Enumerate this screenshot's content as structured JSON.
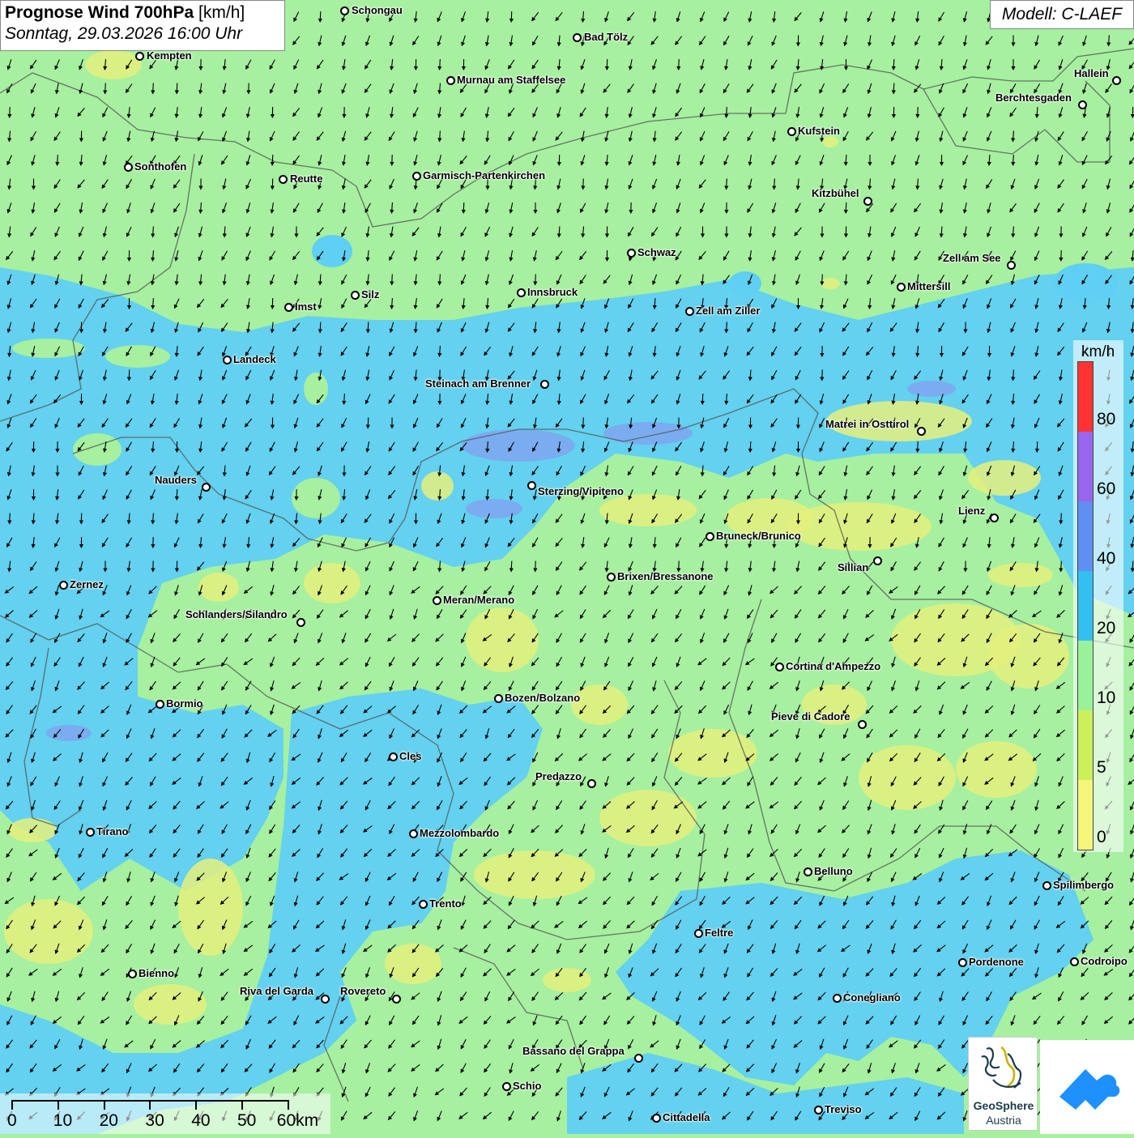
{
  "header": {
    "title": "Prognose Wind 700hPa",
    "unit": "[km/h]",
    "datetime": "Sonntag, 29.03.2026 16:00 Uhr",
    "model": "Modell: C-LAEF"
  },
  "legend": {
    "unit": "km/h",
    "labels": [
      "80",
      "60",
      "40",
      "20",
      "10",
      "5",
      "0"
    ],
    "colors": [
      "#ff3333",
      "#9966ee",
      "#5f8ff0",
      "#33bff0",
      "#99f199",
      "#ccf05a",
      "#f5f57a"
    ]
  },
  "scalebar": {
    "labels": [
      "0",
      "10",
      "20",
      "30",
      "40",
      "50",
      "60km"
    ]
  },
  "logo": {
    "line1": "GeoSphere",
    "line2": "Austria"
  },
  "cities": [
    {
      "name": "Schongau",
      "dot": [
        425,
        13
      ],
      "label": [
        434,
        13
      ]
    },
    {
      "name": "Bad Tölz",
      "dot": [
        712,
        46
      ],
      "label": [
        721,
        46
      ]
    },
    {
      "name": "Kempten",
      "dot": [
        172,
        69
      ],
      "label": [
        181,
        69
      ]
    },
    {
      "name": "Murnau am Staffelsee",
      "dot": [
        556,
        99
      ],
      "label": [
        564,
        99
      ]
    },
    {
      "name": "Hallein",
      "dot": [
        1378,
        99
      ],
      "label": [
        1326,
        91
      ]
    },
    {
      "name": "Berchtesgaden",
      "dot": [
        1336,
        129
      ],
      "label": [
        1229,
        121
      ]
    },
    {
      "name": "Kufstein",
      "dot": [
        977,
        162
      ],
      "label": [
        985,
        162
      ]
    },
    {
      "name": "Sonthofen",
      "dot": [
        158,
        206
      ],
      "label": [
        166,
        206
      ]
    },
    {
      "name": "Reutte",
      "dot": [
        349,
        221
      ],
      "label": [
        358,
        221
      ]
    },
    {
      "name": "Garmisch-Partenkirchen",
      "dot": [
        514,
        217
      ],
      "label": [
        522,
        217
      ]
    },
    {
      "name": "Kitzbühel",
      "dot": [
        1071,
        248
      ],
      "label": [
        1002,
        239
      ]
    },
    {
      "name": "Schwaz",
      "dot": [
        779,
        312
      ],
      "label": [
        787,
        312
      ]
    },
    {
      "name": "Zell am See",
      "dot": [
        1248,
        327
      ],
      "label": [
        1164,
        319
      ]
    },
    {
      "name": "Mittersill",
      "dot": [
        1112,
        354
      ],
      "label": [
        1120,
        354
      ]
    },
    {
      "name": "Innsbruck",
      "dot": [
        643,
        361
      ],
      "label": [
        651,
        361
      ]
    },
    {
      "name": "Silz",
      "dot": [
        438,
        364
      ],
      "label": [
        446,
        364
      ]
    },
    {
      "name": "Imst",
      "dot": [
        356,
        379
      ],
      "label": [
        364,
        379
      ]
    },
    {
      "name": "Zell am Ziller",
      "dot": [
        851,
        384
      ],
      "label": [
        859,
        384
      ]
    },
    {
      "name": "Landeck",
      "dot": [
        280,
        444
      ],
      "label": [
        288,
        444
      ]
    },
    {
      "name": "Steinach am Brenner",
      "dot": [
        672,
        474
      ],
      "label": [
        525,
        474
      ]
    },
    {
      "name": "Matrei in Osttirol",
      "dot": [
        1137,
        532
      ],
      "label": [
        1019,
        524
      ]
    },
    {
      "name": "Nauders",
      "dot": [
        254,
        601
      ],
      "label": [
        191,
        593
      ]
    },
    {
      "name": "Sterzing/Vipiteno",
      "dot": [
        656,
        599
      ],
      "label": [
        664,
        607
      ]
    },
    {
      "name": "Lienz",
      "dot": [
        1227,
        639
      ],
      "label": [
        1183,
        631
      ]
    },
    {
      "name": "Bruneck/Brunico",
      "dot": [
        876,
        662
      ],
      "label": [
        884,
        662
      ]
    },
    {
      "name": "Sillian",
      "dot": [
        1083,
        692
      ],
      "label": [
        1034,
        701
      ]
    },
    {
      "name": "Brixen/Bressanone",
      "dot": [
        754,
        712
      ],
      "label": [
        762,
        712
      ]
    },
    {
      "name": "Zernez",
      "dot": [
        78,
        722
      ],
      "label": [
        86,
        722
      ]
    },
    {
      "name": "Meran/Merano",
      "dot": [
        539,
        741
      ],
      "label": [
        547,
        741
      ]
    },
    {
      "name": "Schlanders/Silandro",
      "dot": [
        371,
        768
      ],
      "label": [
        229,
        759
      ]
    },
    {
      "name": "Cortina d'Ampezzo",
      "dot": [
        962,
        823
      ],
      "label": [
        970,
        823
      ]
    },
    {
      "name": "Bozen/Bolzano",
      "dot": [
        615,
        862
      ],
      "label": [
        623,
        862
      ]
    },
    {
      "name": "Bormio",
      "dot": [
        197,
        869
      ],
      "label": [
        205,
        869
      ]
    },
    {
      "name": "Pieve di Cadore",
      "dot": [
        1064,
        894
      ],
      "label": [
        952,
        885
      ]
    },
    {
      "name": "Cles",
      "dot": [
        485,
        934
      ],
      "label": [
        493,
        934
      ]
    },
    {
      "name": "Predazzo",
      "dot": [
        730,
        967
      ],
      "label": [
        661,
        959
      ]
    },
    {
      "name": "Tirano",
      "dot": [
        111,
        1027
      ],
      "label": [
        119,
        1027
      ]
    },
    {
      "name": "Mezzolombardo",
      "dot": [
        510,
        1029
      ],
      "label": [
        518,
        1029
      ]
    },
    {
      "name": "Belluno",
      "dot": [
        997,
        1076
      ],
      "label": [
        1005,
        1076
      ]
    },
    {
      "name": "Spilimbergo",
      "dot": [
        1292,
        1093
      ],
      "label": [
        1300,
        1093
      ]
    },
    {
      "name": "Trento",
      "dot": [
        522,
        1116
      ],
      "label": [
        530,
        1116
      ]
    },
    {
      "name": "Feltre",
      "dot": [
        862,
        1152
      ],
      "label": [
        870,
        1152
      ]
    },
    {
      "name": "Pordenone",
      "dot": [
        1188,
        1188
      ],
      "label": [
        1196,
        1188
      ]
    },
    {
      "name": "Codroipo",
      "dot": [
        1326,
        1187
      ],
      "label": [
        1334,
        1187
      ]
    },
    {
      "name": "Bienno",
      "dot": [
        163,
        1202
      ],
      "label": [
        171,
        1202
      ]
    },
    {
      "name": "Riva del Garda",
      "dot": [
        401,
        1233
      ],
      "label": [
        296,
        1224
      ]
    },
    {
      "name": "Rovereto",
      "dot": [
        489,
        1233
      ],
      "label": [
        420,
        1224
      ]
    },
    {
      "name": "Conegliano",
      "dot": [
        1033,
        1232
      ],
      "label": [
        1041,
        1232
      ]
    },
    {
      "name": "Bassano del Grappa",
      "dot": [
        788,
        1306
      ],
      "label": [
        645,
        1298
      ]
    },
    {
      "name": "Schio",
      "dot": [
        625,
        1341
      ],
      "label": [
        633,
        1341
      ]
    },
    {
      "name": "Treviso",
      "dot": [
        1010,
        1370
      ],
      "label": [
        1018,
        1370
      ]
    },
    {
      "name": "Cittadella",
      "dot": [
        810,
        1380
      ],
      "label": [
        818,
        1380
      ]
    }
  ]
}
